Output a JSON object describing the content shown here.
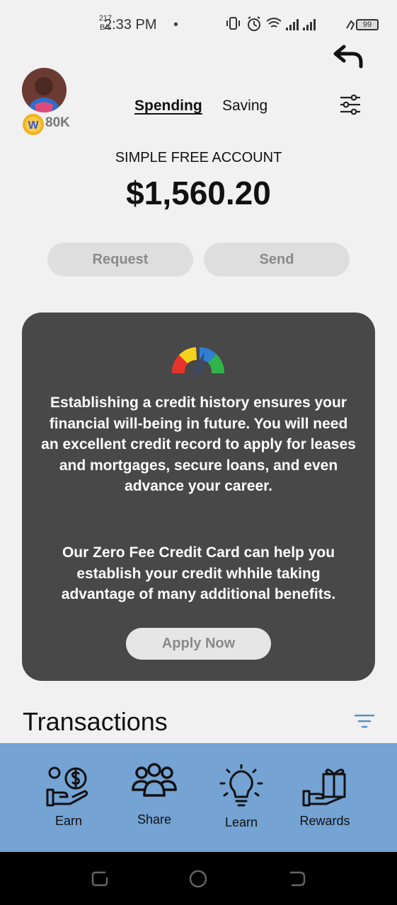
{
  "status_bar": {
    "time": "2:33 PM",
    "dot": "•",
    "net_speed": "217",
    "net_unit": "B/s",
    "battery": "99"
  },
  "profile": {
    "coin_count": "80K",
    "coin_letter": "W"
  },
  "tabs": [
    {
      "label": "Spending",
      "active": true
    },
    {
      "label": "Saving",
      "active": false
    }
  ],
  "account": {
    "name": "SIMPLE FREE ACCOUNT",
    "balance": "$1,560.20"
  },
  "actions": {
    "request": "Request",
    "send": "Send"
  },
  "promo": {
    "paragraph1": "Establishing a credit history ensures your financial will-being in future. You will need an excellent credit record to apply for leases and mortgages, secure loans, and even advance your career.",
    "paragraph2": "Our Zero Fee Credit Card can help you establish your credit whhile taking advantage of many additional benefits.",
    "button": "Apply Now",
    "gauge_colors": [
      "#e8332a",
      "#f6d21c",
      "#2f7fd6",
      "#2fb34a"
    ]
  },
  "transactions": {
    "title": "Transactions"
  },
  "bottom_nav": [
    {
      "label": "Earn",
      "icon": "earn-icon"
    },
    {
      "label": "Share",
      "icon": "share-icon"
    },
    {
      "label": "Learn",
      "icon": "learn-icon"
    },
    {
      "label": "Rewards",
      "icon": "rewards-icon"
    }
  ],
  "colors": {
    "nav_bg": "#74a3d4",
    "promo_bg": "#484848",
    "page_bg": "#f1f1f1"
  }
}
